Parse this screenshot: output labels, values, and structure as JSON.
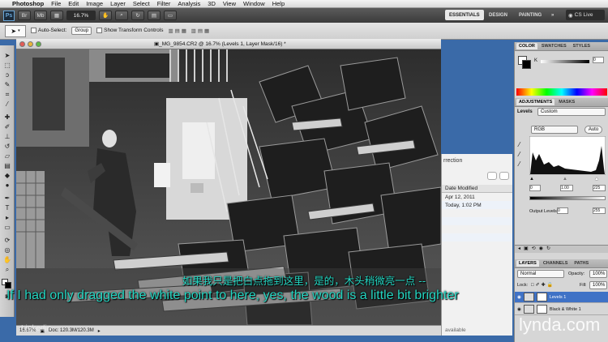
{
  "menubar": {
    "apple": "",
    "items": [
      "Photoshop",
      "File",
      "Edit",
      "Image",
      "Layer",
      "Select",
      "Filter",
      "Analysis",
      "3D",
      "View",
      "Window",
      "Help"
    ]
  },
  "appbar": {
    "logo": "Ps",
    "zoom": "16.7%",
    "workspaces": [
      "ESSENTIALS",
      "DESIGN",
      "PAINTING",
      "»"
    ],
    "cs_live": "CS Live"
  },
  "options": {
    "auto_select_label": "Auto-Select:",
    "auto_select_value": "Group",
    "show_transform_label": "Show Transform Controls"
  },
  "document": {
    "title": "_MG_9854.CR2 @ 16.7% (Levels 1, Layer Mask/16) *",
    "zoom": "16.67%",
    "doc_size": "Doc: 120.3M/120.3M"
  },
  "behind_window": {
    "header": "rrection",
    "col_header": "Date Modified",
    "rows": [
      "Apr 12, 2011",
      "Today, 1:02 PM"
    ],
    "footer": "available"
  },
  "panels": {
    "color_tabs": [
      "COLOR",
      "SWATCHES",
      "STYLES"
    ],
    "adjust_tabs": [
      "ADJUSTMENTS",
      "MASKS"
    ],
    "levels_label": "Levels",
    "preset": "Custom",
    "channel": "RGB",
    "auto_label": "Auto",
    "input_levels": [
      "0",
      "1.00",
      "225"
    ],
    "output_label": "Output Levels:",
    "output_levels": [
      "0",
      "255"
    ],
    "layer_tabs": [
      "LAYERS",
      "CHANNELS",
      "PATHS"
    ],
    "blend_mode": "Normal",
    "opacity_label": "Opacity:",
    "opacity": "100%",
    "lock_label": "Lock:",
    "fill_label": "Fill:",
    "fill": "100%",
    "layers": [
      "Levels 1",
      "Black & White 1"
    ]
  },
  "subtitles": {
    "chinese": "如果我只是把白点拖到这里，是的，木头稍微亮一点 --",
    "english": "If I had only dragged the white point to  here, yes, the wood is a little bit brighter"
  },
  "watermarks": {
    "lynda": "lynda.com",
    "linkedin": "Linkedin"
  },
  "colors": {
    "accent_blue": "#3a6aa8",
    "subtitle": "#24d6c2"
  }
}
